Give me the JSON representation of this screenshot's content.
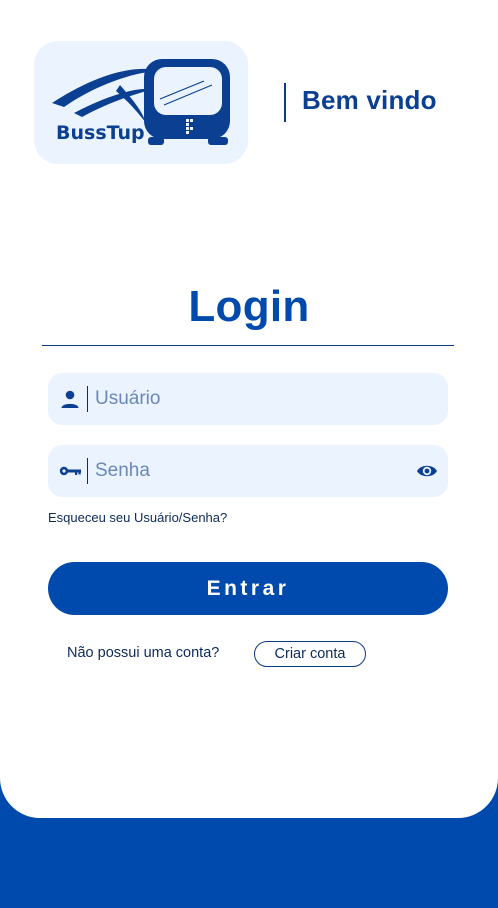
{
  "header": {
    "logo_text": "BussTup",
    "welcome": "Bem vindo"
  },
  "login": {
    "title": "Login",
    "username": {
      "placeholder": "Usuário",
      "value": ""
    },
    "password": {
      "placeholder": "Senha",
      "value": ""
    },
    "forgot_link": "Esqueceu seu Usuário/Senha?",
    "submit_label": "Entrar",
    "signup_prompt": "Não possui uma conta?",
    "signup_button": "Criar conta"
  },
  "icons": {
    "user_field": "user-icon",
    "password_field": "key-icon",
    "toggle_visibility": "eye-icon"
  },
  "colors": {
    "brand_blue": "#004aad",
    "field_bg": "#eaf3fe",
    "placeholder": "#6b87b8",
    "text_dark": "#0b2a5a",
    "background": "#ffffff"
  }
}
